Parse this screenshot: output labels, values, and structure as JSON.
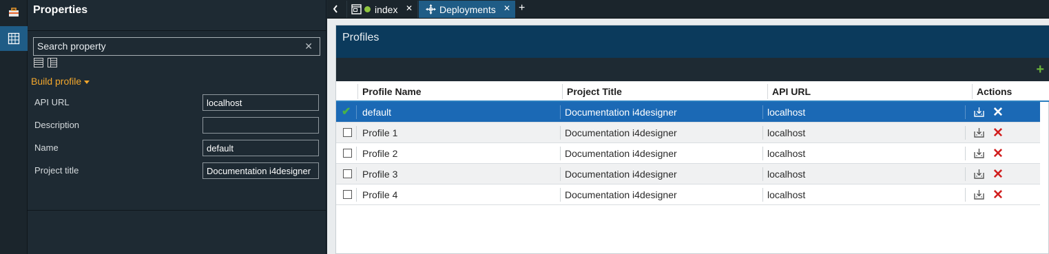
{
  "rail": {
    "items": [
      {
        "icon": "toolbox-icon"
      },
      {
        "icon": "properties-grid-icon",
        "active": true
      }
    ]
  },
  "panel": {
    "title": "Properties",
    "search": {
      "placeholder": "Search property",
      "value": "",
      "clear_glyph": "✕"
    },
    "view_icons": [
      "list-view-icon",
      "detail-view-icon"
    ],
    "section": "Build profile",
    "properties": [
      {
        "label": "API URL",
        "value": "localhost"
      },
      {
        "label": "Description",
        "value": ""
      },
      {
        "label": "Name",
        "value": "default"
      },
      {
        "label": "Project title",
        "value": "Documentation i4designer"
      }
    ]
  },
  "tabs": {
    "items": [
      {
        "label": "index",
        "icon": "page-icon",
        "status_color": "#8fc640",
        "close": "✕"
      },
      {
        "label": "Deployments",
        "icon": "move-icon",
        "active": true,
        "close": "✕"
      }
    ],
    "add_label": "+"
  },
  "profiles": {
    "title": "Profiles",
    "add_label": "+",
    "columns": [
      "Profile Name",
      "Project Title",
      "API URL",
      "Actions"
    ],
    "rows": [
      {
        "name": "default",
        "project": "Documentation i4designer",
        "url": "localhost",
        "checked": true,
        "selected": true
      },
      {
        "name": "Profile 1",
        "project": "Documentation i4designer",
        "url": "localhost",
        "checked": false
      },
      {
        "name": "Profile 2",
        "project": "Documentation i4designer",
        "url": "localhost",
        "checked": false
      },
      {
        "name": "Profile 3",
        "project": "Documentation i4designer",
        "url": "localhost",
        "checked": false
      },
      {
        "name": "Profile 4",
        "project": "Documentation i4designer",
        "url": "localhost",
        "checked": false
      }
    ],
    "colors": {
      "header": "#0b3a5c",
      "selected_row": "#1b69b5",
      "delete": "#d11f1f",
      "add": "#6ab33b"
    }
  }
}
